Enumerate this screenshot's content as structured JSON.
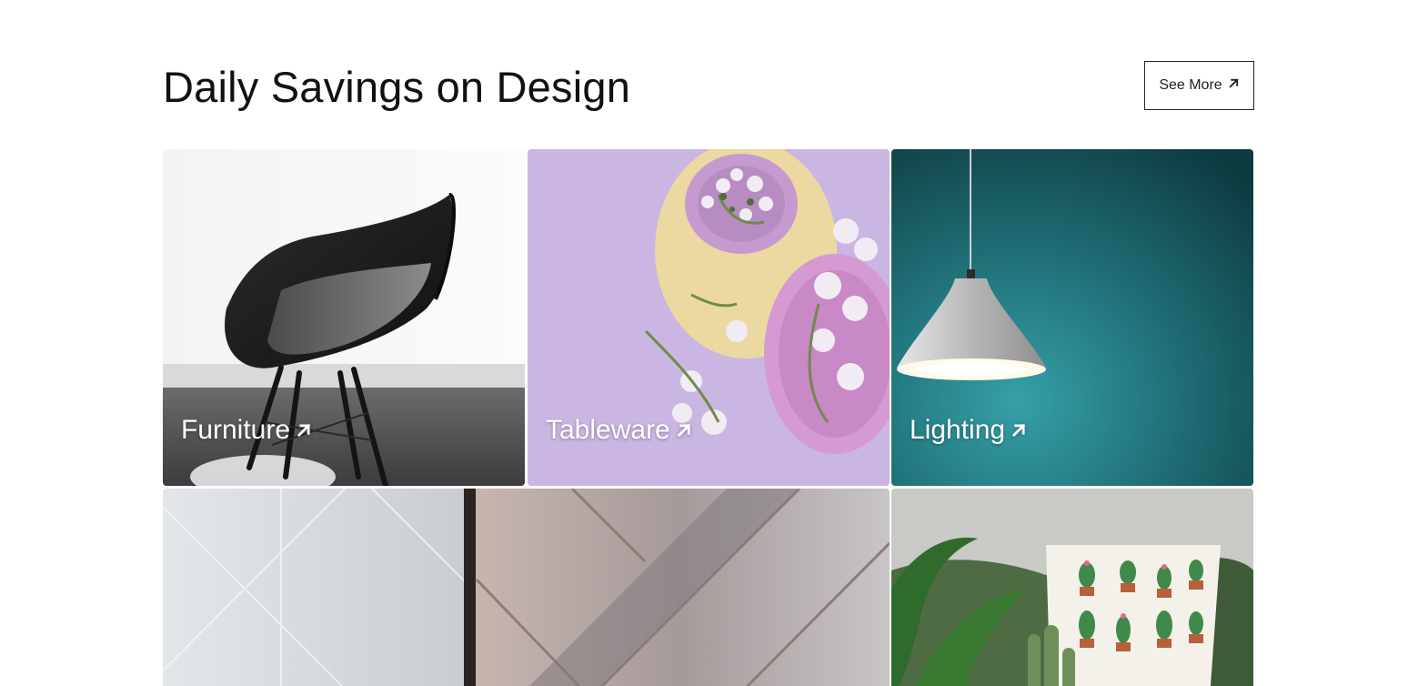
{
  "section": {
    "title": "Daily Savings on Design",
    "see_more_label": "See More",
    "see_more_icon": "arrow-up-right-icon"
  },
  "categories": [
    {
      "label": "Furniture",
      "icon": "arrow-up-right-icon",
      "image": "black-shell-chair-photo"
    },
    {
      "label": "Tableware",
      "icon": "arrow-up-right-icon",
      "image": "plates-and-flowers-photo"
    },
    {
      "label": "Lighting",
      "icon": "arrow-up-right-icon",
      "image": "pendant-lamp-photo"
    },
    {
      "label": "",
      "icon": "",
      "image": "geometric-wall-panels-photo"
    },
    {
      "label": "",
      "icon": "",
      "image": "cactus-pillow-photo"
    }
  ],
  "colors": {
    "background": "#ffffff",
    "text": "#111111",
    "button_border": "#222222",
    "tile_label": "#ffffff",
    "lavender": "#c9b6e2",
    "teal": "#1f6c73"
  }
}
